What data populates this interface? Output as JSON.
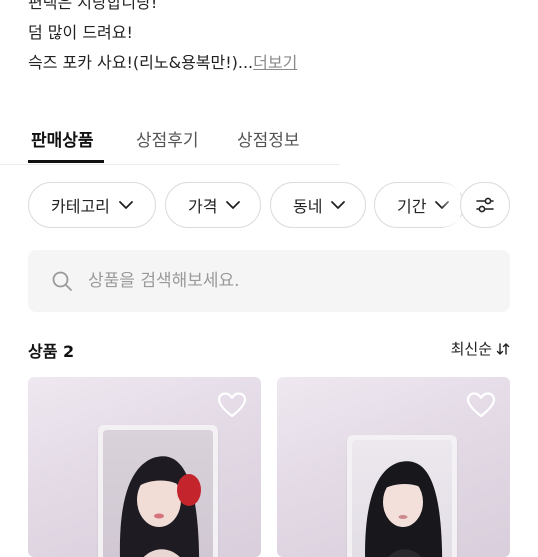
{
  "store": {
    "description_lines": [
      "편택은 지랑합니당!",
      "덤 많이 드려요!",
      "슥즈 포카 사요!(리노&용복만!)..."
    ],
    "more_label": "더보기"
  },
  "tabs": [
    {
      "label": "판매상품",
      "active": true
    },
    {
      "label": "상점후기",
      "active": false
    },
    {
      "label": "상점정보",
      "active": false
    }
  ],
  "filters": [
    {
      "label": "카테고리",
      "icon": "chevron-down-icon"
    },
    {
      "label": "가격",
      "icon": "chevron-down-icon"
    },
    {
      "label": "동네",
      "icon": "chevron-down-icon"
    },
    {
      "label": "기간",
      "icon": "chevron-down-icon"
    }
  ],
  "filter_settings_icon": "sliders-icon",
  "search": {
    "placeholder": "상품을 검색해보세요.",
    "value": ""
  },
  "products": {
    "count_label": "상품 2",
    "sort_label": "최신순",
    "items": [
      {
        "liked": false,
        "icon": "heart-outline-icon"
      },
      {
        "liked": false,
        "icon": "heart-outline-icon"
      }
    ]
  },
  "colors": {
    "text": "#111111",
    "muted": "#8a8a8a",
    "border": "#dcdcdc",
    "search_bg": "#f5f5f5",
    "active_underline": "#111111"
  }
}
